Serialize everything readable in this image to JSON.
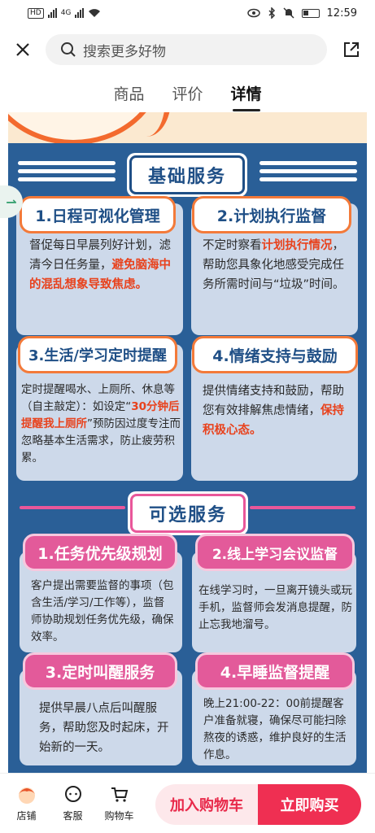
{
  "status_bar": {
    "left_chip": "HD",
    "network": "4G",
    "time": "12:59"
  },
  "header": {
    "search_placeholder": "搜索更多好物"
  },
  "tabs": [
    {
      "label": "商品",
      "active": false
    },
    {
      "label": "评价",
      "active": false
    },
    {
      "label": "详情",
      "active": true
    }
  ],
  "basic": {
    "title": "基础服务",
    "cards": [
      {
        "title": "1.日程可视化管理",
        "body": [
          "督促每日早晨列好计划，滤清今日任务量，",
          {
            "hl": "避免脑海中的混乱想象导致焦虑。"
          }
        ]
      },
      {
        "title": "2.计划执行监督",
        "body": [
          "不定时察看",
          {
            "hl": "计划执行情况"
          },
          "，帮助您具象化地感受完成任务所需时间与“垃圾”时间。"
        ]
      },
      {
        "title": "3.生活/学习定时提醒",
        "body": [
          "定时提醒喝水、上厕所、休息等（自主敲定）：如设定“",
          {
            "hl": "30分钟后提醒我上厕所"
          },
          "”预防因过度专注而忽略基本生活需求，防止疲劳积累。"
        ]
      },
      {
        "title": "4.情绪支持与鼓励",
        "body": [
          "提供情绪支持和鼓励，帮助您有效排解焦虑情绪，",
          {
            "hl": "保持积极心态。"
          }
        ]
      }
    ]
  },
  "optional": {
    "title": "可选服务",
    "cards": [
      {
        "title": "1.任务优先级规划",
        "body": "客户提出需要监督的事项（包含生活/学习/工作等），监督师协助规划任务优先级，确保效率。"
      },
      {
        "title": "2.线上学习会议监督",
        "body": "在线学习时，一旦离开镜头或玩手机，监督师会发消息提醒，防止忘我地溜号。"
      },
      {
        "title": "3.定时叫醒服务",
        "body": "提供早晨八点后叫醒服务，帮助您及时起床，开始新的一天。"
      },
      {
        "title": "4.早睡监督提醒",
        "body": "晚上21:00-22：00前提醒客户准备就寝，确保尽可能扫除熬夜的诱惑，维护良好的生活作息。"
      }
    ]
  },
  "bottom_bar": {
    "store": "店铺",
    "service": "客服",
    "cart": "购物车",
    "add_to_cart": "加入购物车",
    "buy_now": "立即购买"
  },
  "colors": {
    "poster_blue": "#2a5f97",
    "card_bg": "#cdd9ea",
    "highlight": "#e8421d",
    "accent_pink": "#e35a9a",
    "buy_red": "#ef2f52"
  }
}
